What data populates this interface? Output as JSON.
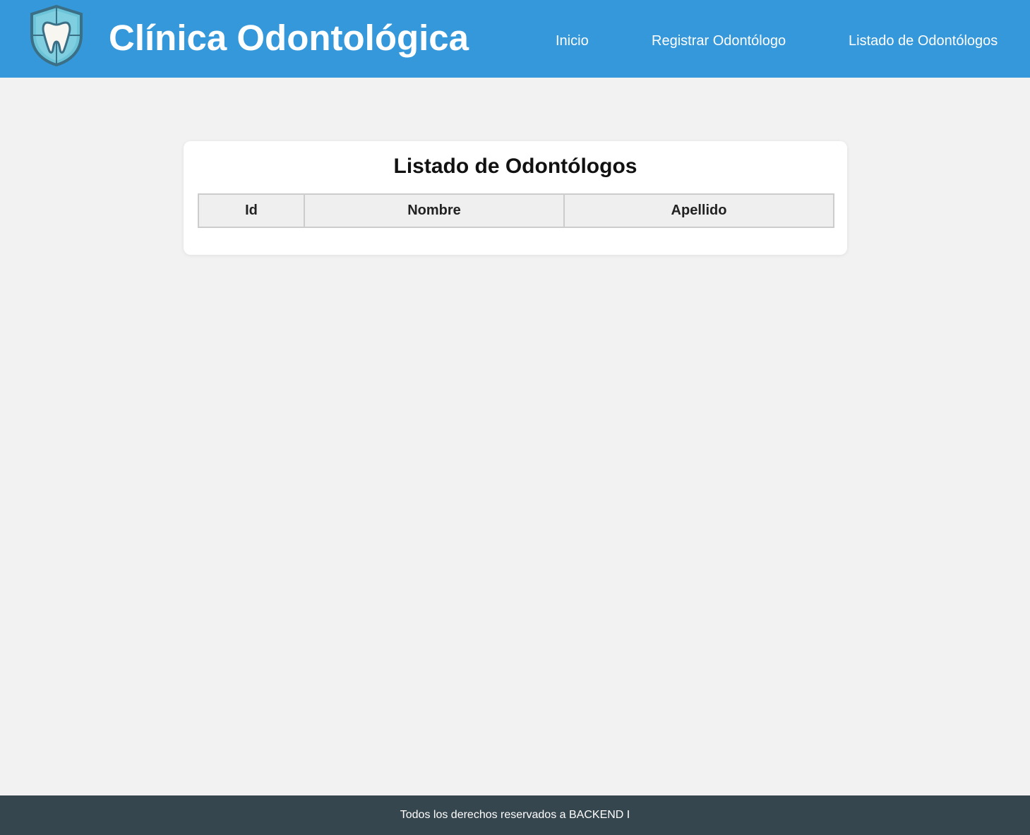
{
  "header": {
    "logo_icon": "tooth-shield-icon",
    "title": "Clínica Odontológica",
    "nav": [
      {
        "label": "Inicio"
      },
      {
        "label": "Registrar Odontólogo"
      },
      {
        "label": "Listado de Odontólogos"
      }
    ]
  },
  "main": {
    "title": "Listado de Odontólogos",
    "table": {
      "columns": [
        "Id",
        "Nombre",
        "Apellido"
      ],
      "rows": []
    }
  },
  "footer": {
    "text": "Todos los derechos reservados a BACKEND I"
  },
  "colors": {
    "header_bg": "#3598db",
    "page_bg": "#f2f2f2",
    "footer_bg": "#36464f",
    "table_header_bg": "#efefef"
  }
}
